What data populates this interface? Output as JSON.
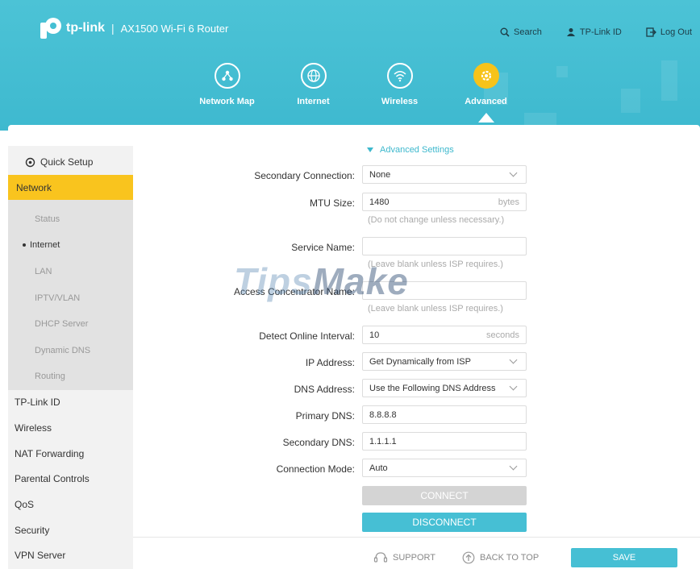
{
  "brand": {
    "name": "tp-link",
    "separator": "|",
    "model": "AX1500 Wi-Fi 6 Router"
  },
  "top_links": {
    "search": "Search",
    "tplink_id": "TP-Link ID",
    "logout": "Log Out"
  },
  "nav": [
    {
      "label": "Network Map",
      "icon": "network-map-icon"
    },
    {
      "label": "Internet",
      "icon": "globe-icon"
    },
    {
      "label": "Wireless",
      "icon": "wifi-icon"
    },
    {
      "label": "Advanced",
      "icon": "gear-icon",
      "active": true
    }
  ],
  "sidebar": {
    "quick_setup": "Quick Setup",
    "network": "Network",
    "network_sub": [
      "Status",
      "Internet",
      "LAN",
      "IPTV/VLAN",
      "DHCP Server",
      "Dynamic DNS",
      "Routing"
    ],
    "selected_sub": "Internet",
    "items": [
      "TP-Link ID",
      "Wireless",
      "NAT Forwarding",
      "Parental Controls",
      "QoS",
      "Security",
      "VPN Server"
    ]
  },
  "form": {
    "advanced_toggle": "Advanced Settings",
    "secondary_connection": {
      "label": "Secondary Connection:",
      "value": "None"
    },
    "mtu": {
      "label": "MTU Size:",
      "value": "1480",
      "suffix": "bytes",
      "hint": "(Do not change unless necessary.)"
    },
    "service_name": {
      "label": "Service Name:",
      "value": "",
      "hint": "(Leave blank unless ISP requires.)"
    },
    "access_concentrator": {
      "label": "Access Concentrator Name:",
      "value": "",
      "hint": "(Leave blank unless ISP requires.)"
    },
    "detect_interval": {
      "label": "Detect Online Interval:",
      "value": "10",
      "suffix": "seconds"
    },
    "ip_address": {
      "label": "IP Address:",
      "value": "Get Dynamically from ISP"
    },
    "dns_address": {
      "label": "DNS Address:",
      "value": "Use the Following DNS Address"
    },
    "primary_dns": {
      "label": "Primary DNS:",
      "value": "8.8.8.8"
    },
    "secondary_dns": {
      "label": "Secondary DNS:",
      "value": "1.1.1.1"
    },
    "connection_mode": {
      "label": "Connection Mode:",
      "value": "Auto"
    },
    "connect_label": "CONNECT",
    "disconnect_label": "DISCONNECT"
  },
  "footer": {
    "support": "SUPPORT",
    "back_to_top": "BACK TO TOP",
    "save": "SAVE"
  },
  "watermark": {
    "part1": "Tips",
    "part2": "Make"
  },
  "colors": {
    "header": "#45bfd3",
    "active": "#f9c41e",
    "accent": "#46bfd4"
  }
}
